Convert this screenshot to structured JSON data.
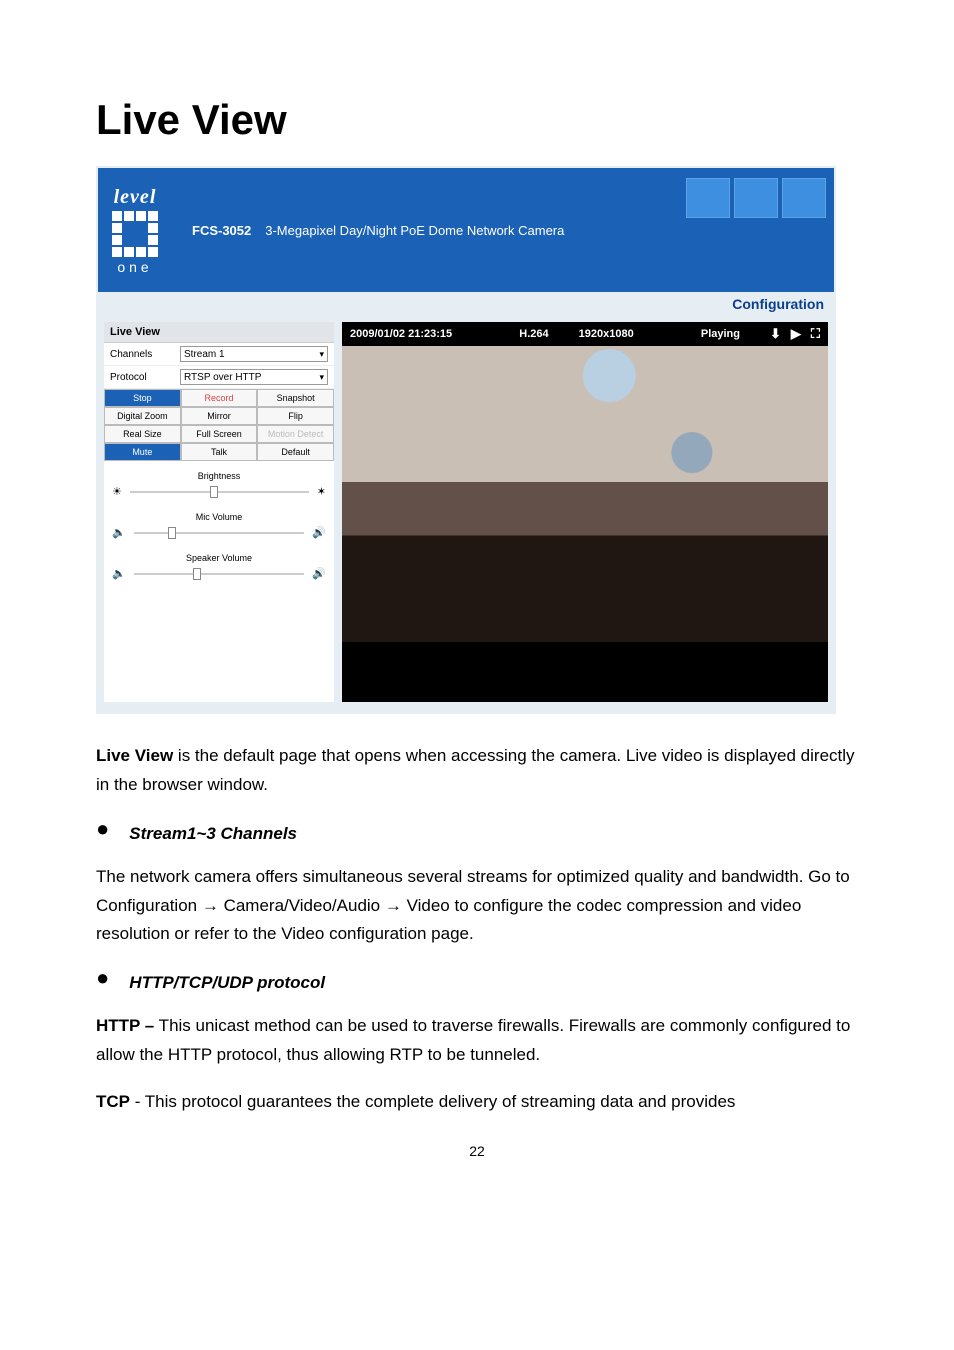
{
  "title": "Live View",
  "header": {
    "logo_top": "level",
    "logo_bottom": "one",
    "model": "FCS-3052",
    "desc": "3-Megapixel Day/Night PoE Dome Network Camera"
  },
  "config_link": "Configuration",
  "panel": {
    "title": "Live View",
    "channels_label": "Channels",
    "protocol_label": "Protocol",
    "channels_value": "Stream 1",
    "protocol_value": "RTSP over HTTP",
    "buttons": {
      "stop": "Stop",
      "record": "Record",
      "snapshot": "Snapshot",
      "digital_zoom": "Digital Zoom",
      "mirror": "Mirror",
      "flip": "Flip",
      "real_size": "Real Size",
      "full_screen": "Full Screen",
      "motion_detect": "Motion Detect",
      "mute": "Mute",
      "talk": "Talk",
      "default": "Default"
    },
    "sliders": {
      "brightness": "Brightness",
      "mic": "Mic Volume",
      "speaker": "Speaker Volume"
    }
  },
  "video_bar": {
    "timestamp": "2009/01/02 21:23:15",
    "codec": "H.264",
    "res": "1920x1080",
    "status": "Playing"
  },
  "body": {
    "p1a": "Live View",
    "p1b": " is the default page that opens when accessing the camera. Live video is displayed directly in the browser window.",
    "bullet1": "Stream1~3 Channels",
    "p2": "The network camera offers simultaneous several streams for optimized quality and bandwidth. Go to Configuration → Camera/Video/Audio → Video to configure the codec compression and video resolution or refer to the Video configuration page.",
    "bullet2": "HTTP/TCP/UDP protocol",
    "p3a": "HTTP –",
    "p3b": " This unicast method can be used to traverse firewalls.    Firewalls are commonly configured to allow the HTTP protocol, thus allowing RTP to be tunneled.",
    "p4a": "TCP",
    "p4b": " - This protocol guarantees the complete delivery of streaming data and provides"
  },
  "page_number": "22"
}
